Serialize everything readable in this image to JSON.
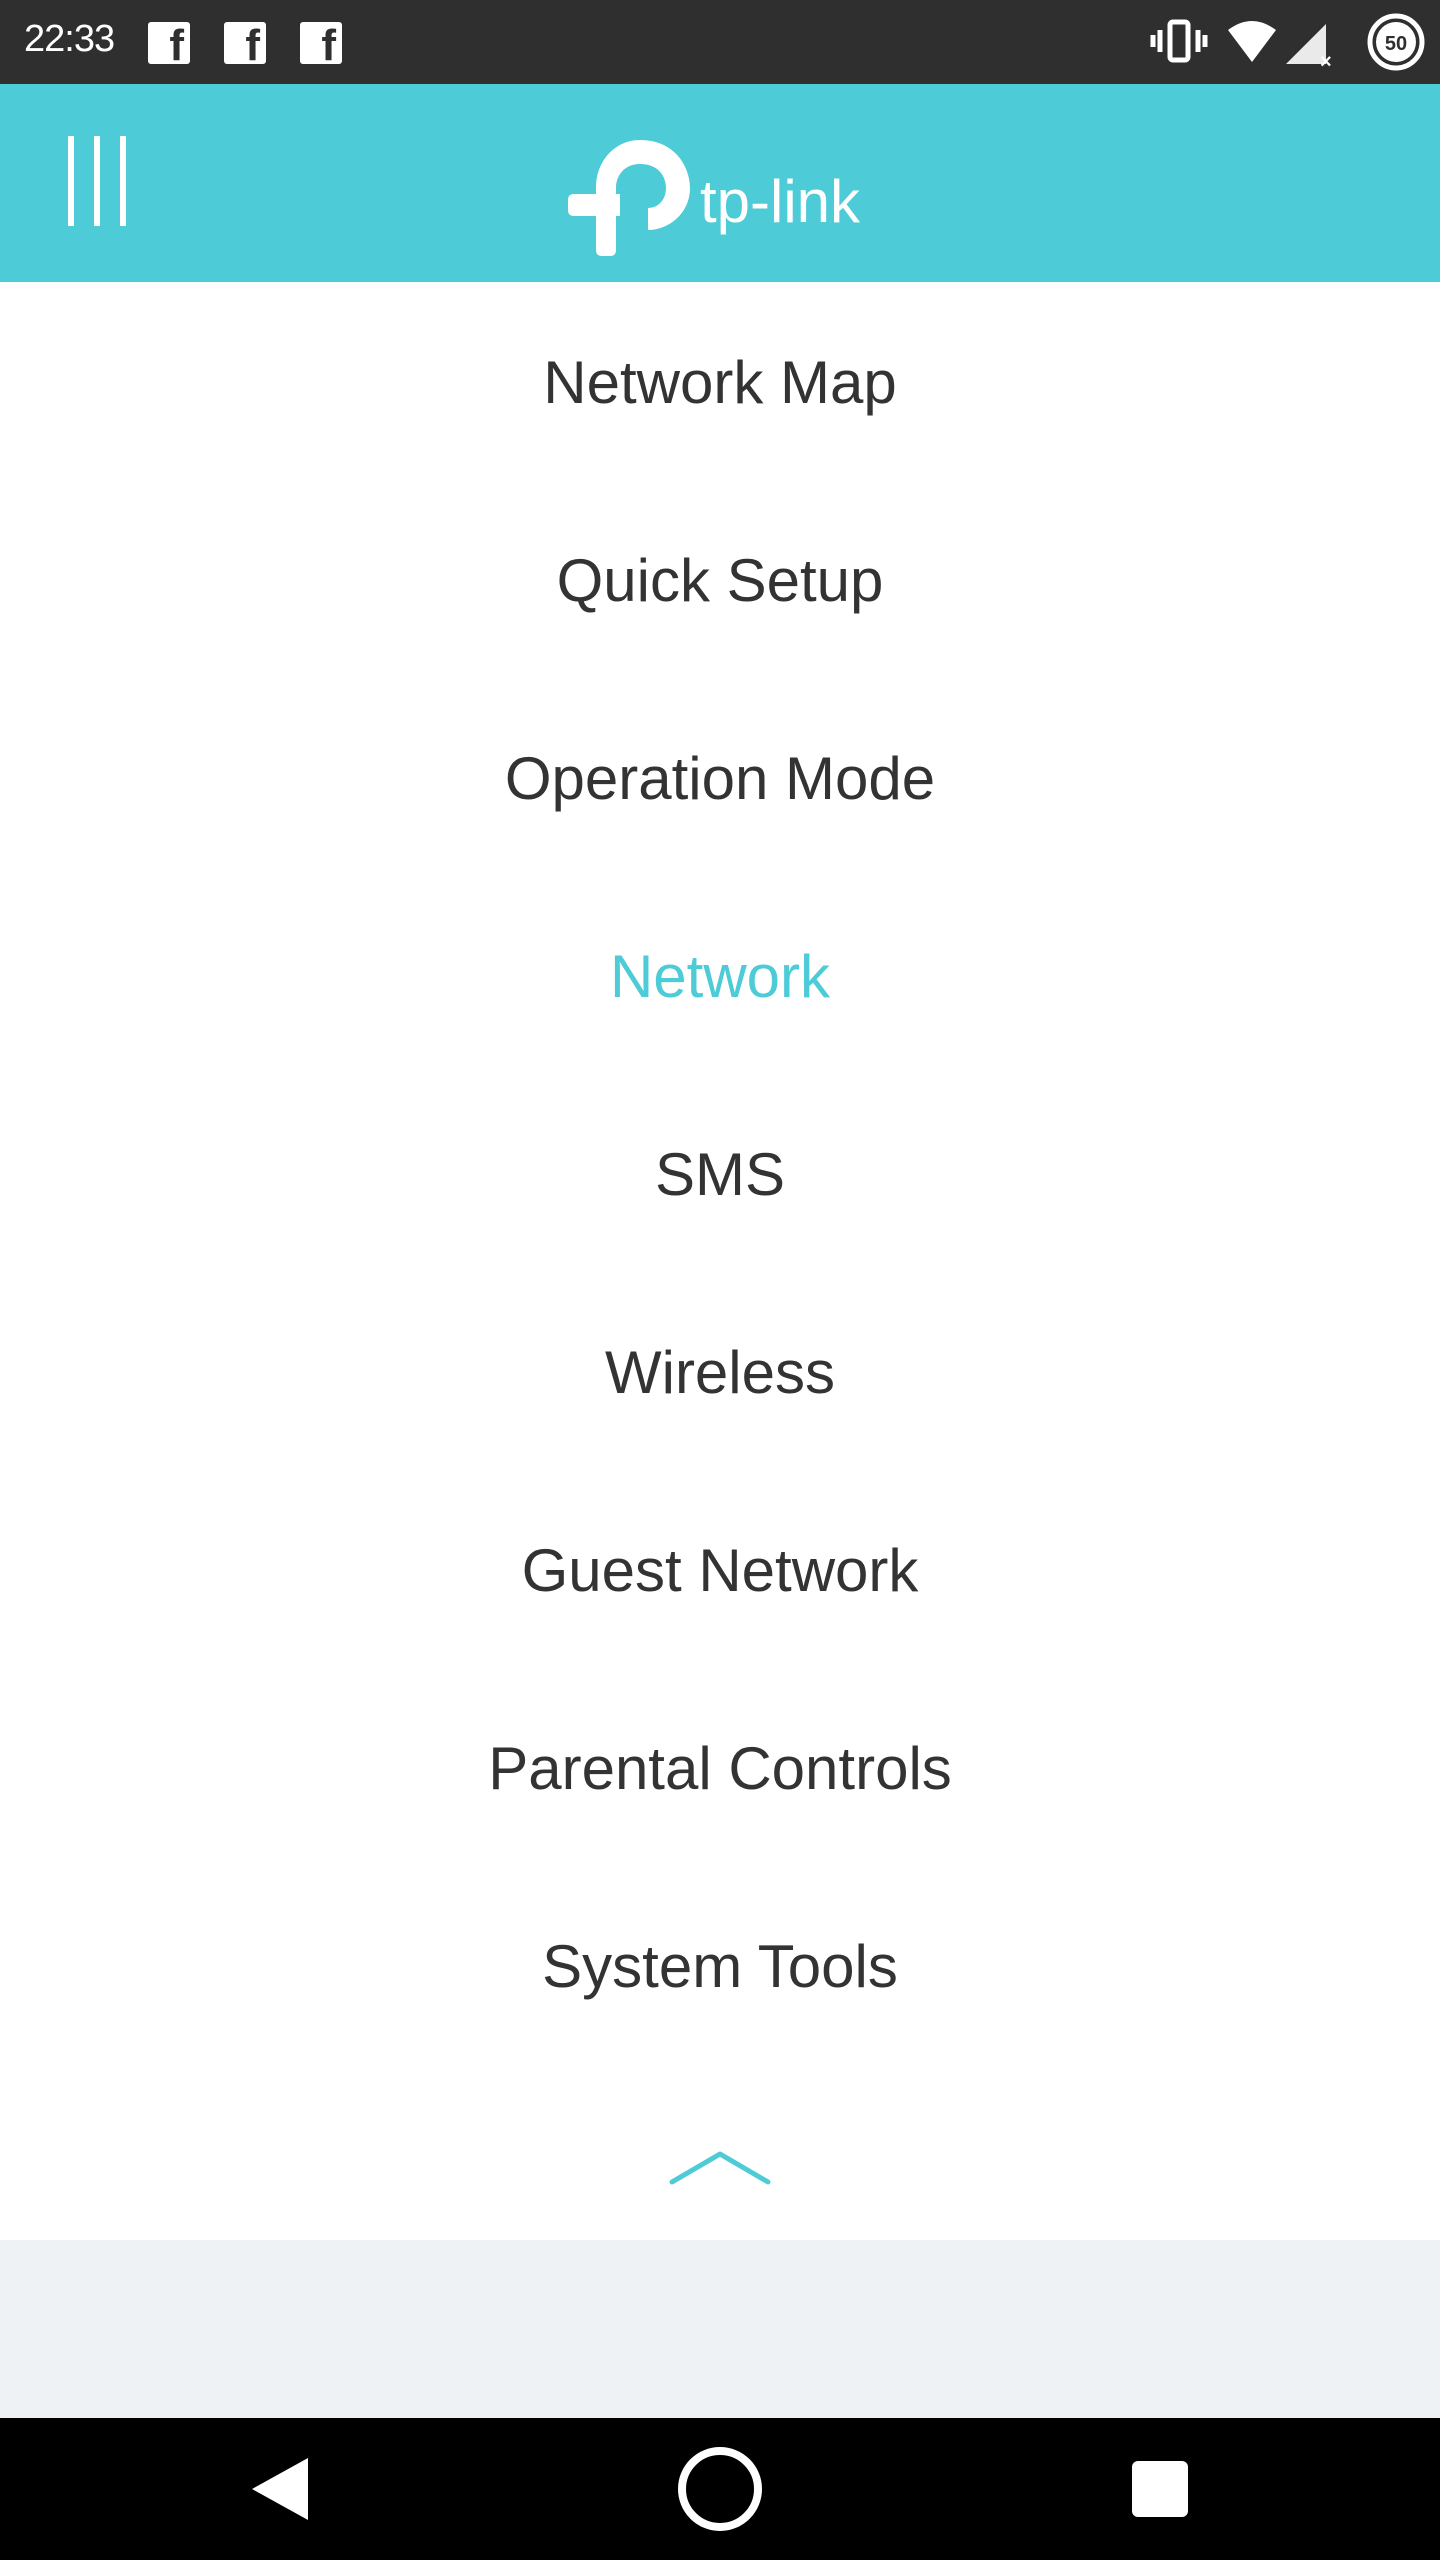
{
  "status_bar": {
    "time": "22:33",
    "notification_icons": [
      "facebook-icon",
      "facebook-icon",
      "facebook-icon"
    ],
    "system_icons": [
      "vibrate-icon",
      "wifi-icon",
      "signal-icon",
      "battery-icon"
    ],
    "battery_level": "50"
  },
  "header": {
    "menu_icon": "menu-icon",
    "logo_text": "tp-link",
    "background_color": "#4dcbd6"
  },
  "menu": {
    "items": [
      {
        "label": "Network Map",
        "active": false
      },
      {
        "label": "Quick Setup",
        "active": false
      },
      {
        "label": "Operation Mode",
        "active": false
      },
      {
        "label": "Network",
        "active": true
      },
      {
        "label": "SMS",
        "active": false
      },
      {
        "label": "Wireless",
        "active": false
      },
      {
        "label": "Guest Network",
        "active": false
      },
      {
        "label": "Parental Controls",
        "active": false
      },
      {
        "label": "System Tools",
        "active": false
      }
    ],
    "collapse_icon": "chevron-up-icon",
    "accent_color": "#4dcbd6",
    "text_color": "#333333"
  },
  "nav_bar": {
    "buttons": [
      "back-icon",
      "home-icon",
      "recents-icon"
    ]
  }
}
